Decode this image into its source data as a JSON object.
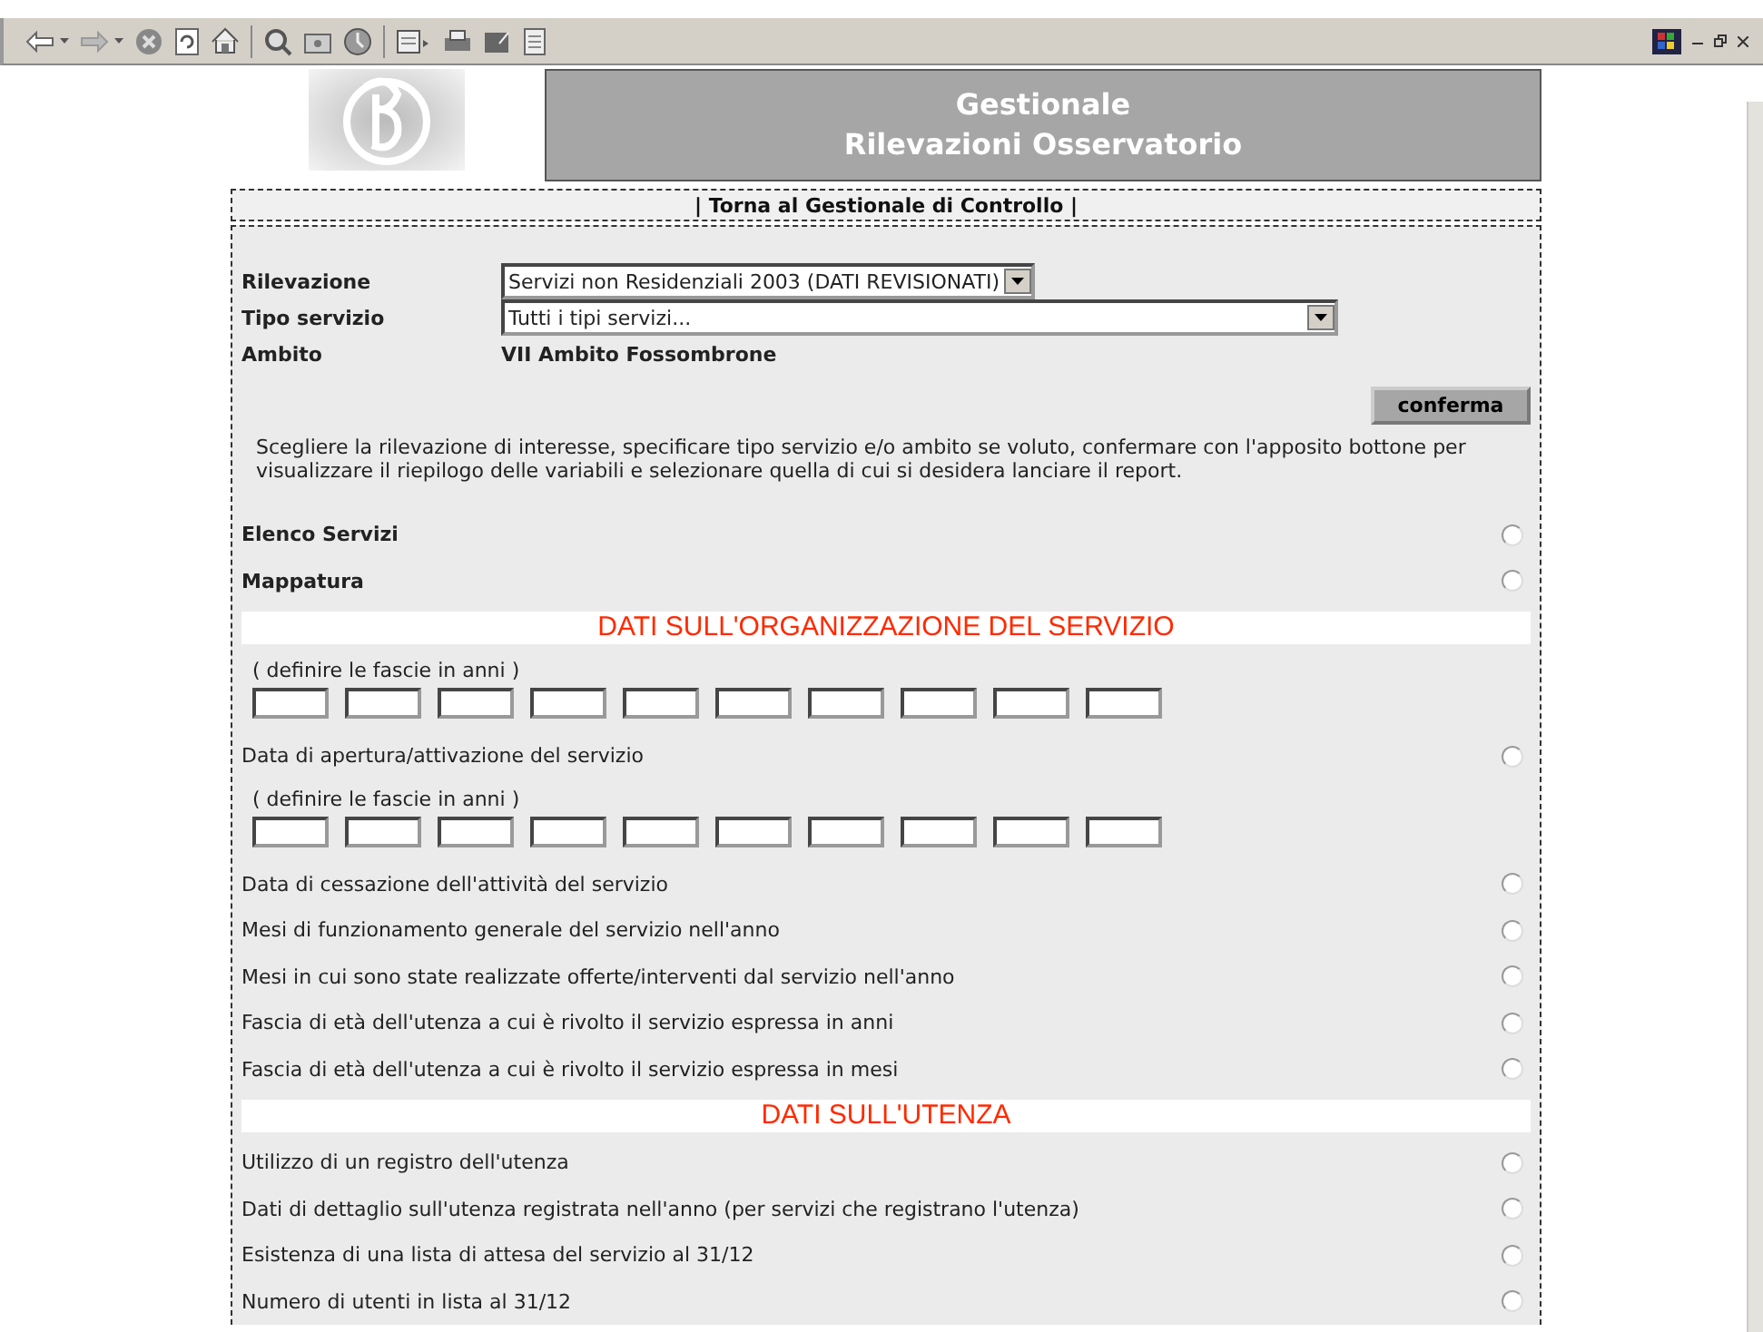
{
  "header": {
    "title_lines": [
      "Gestionale",
      "Rilevazioni Osservatorio"
    ]
  },
  "nav_link": "| Torna al Gestionale di Controllo |",
  "filters": [
    {
      "label": "Rilevazione",
      "kind": "select",
      "value": "Servizi non Residenziali 2003 (DATI REVISIONATI)"
    },
    {
      "label": "Tipo servizio",
      "kind": "select-wide",
      "value": "Tutti i tipi servizi..."
    },
    {
      "label": "Ambito",
      "kind": "text",
      "value": "VII Ambito Fossombrone"
    }
  ],
  "confirm_button": "conferma",
  "instructions": "Scegliere la rilevazione di interesse, specificare tipo servizio e/o ambito se voluto, confermare con l'apposito bottone per visualizzare il riepilogo delle variabili e selezionare quella di cui si desidera lanciare il report.",
  "items": [
    {
      "kind": "main",
      "label": "Elenco Servizi",
      "selected": false
    },
    {
      "kind": "main",
      "label": "Mappatura",
      "selected": false
    },
    {
      "kind": "section",
      "label": "DATI SULL'ORGANIZZAZIONE DEL SERVIZIO"
    },
    {
      "kind": "ranges",
      "label": "( definire le fascie in anni )"
    },
    {
      "kind": "option",
      "label": "Data di apertura/attivazione del servizio",
      "selected": false
    },
    {
      "kind": "ranges",
      "label": "( definire le fascie in anni )"
    },
    {
      "kind": "option",
      "label": "Data di cessazione dell'attività del servizio",
      "selected": false
    },
    {
      "kind": "option",
      "label": "Mesi di funzionamento generale del servizio nell'anno",
      "selected": false
    },
    {
      "kind": "option",
      "label": "Mesi in cui sono state realizzate offerte/interventi dal servizio nell'anno",
      "selected": false
    },
    {
      "kind": "option",
      "label": "Fascia di età dell'utenza a cui è rivolto il servizio espressa in anni",
      "selected": false
    },
    {
      "kind": "option",
      "label": "Fascia di età dell'utenza a cui è rivolto il servizio espressa in mesi",
      "selected": false
    },
    {
      "kind": "section",
      "label": "DATI SULL'UTENZA"
    },
    {
      "kind": "option",
      "label": "Utilizzo di un registro dell'utenza",
      "selected": false
    },
    {
      "kind": "option",
      "label": "Dati di dettaglio sull'utenza registrata nell'anno (per servizi che registrano l'utenza)",
      "selected": false
    },
    {
      "kind": "option",
      "label": "Esistenza di una lista di attesa del servizio al 31/12",
      "selected": false
    },
    {
      "kind": "option",
      "label": "Numero di utenti in lista al 31/12",
      "selected": false
    }
  ]
}
